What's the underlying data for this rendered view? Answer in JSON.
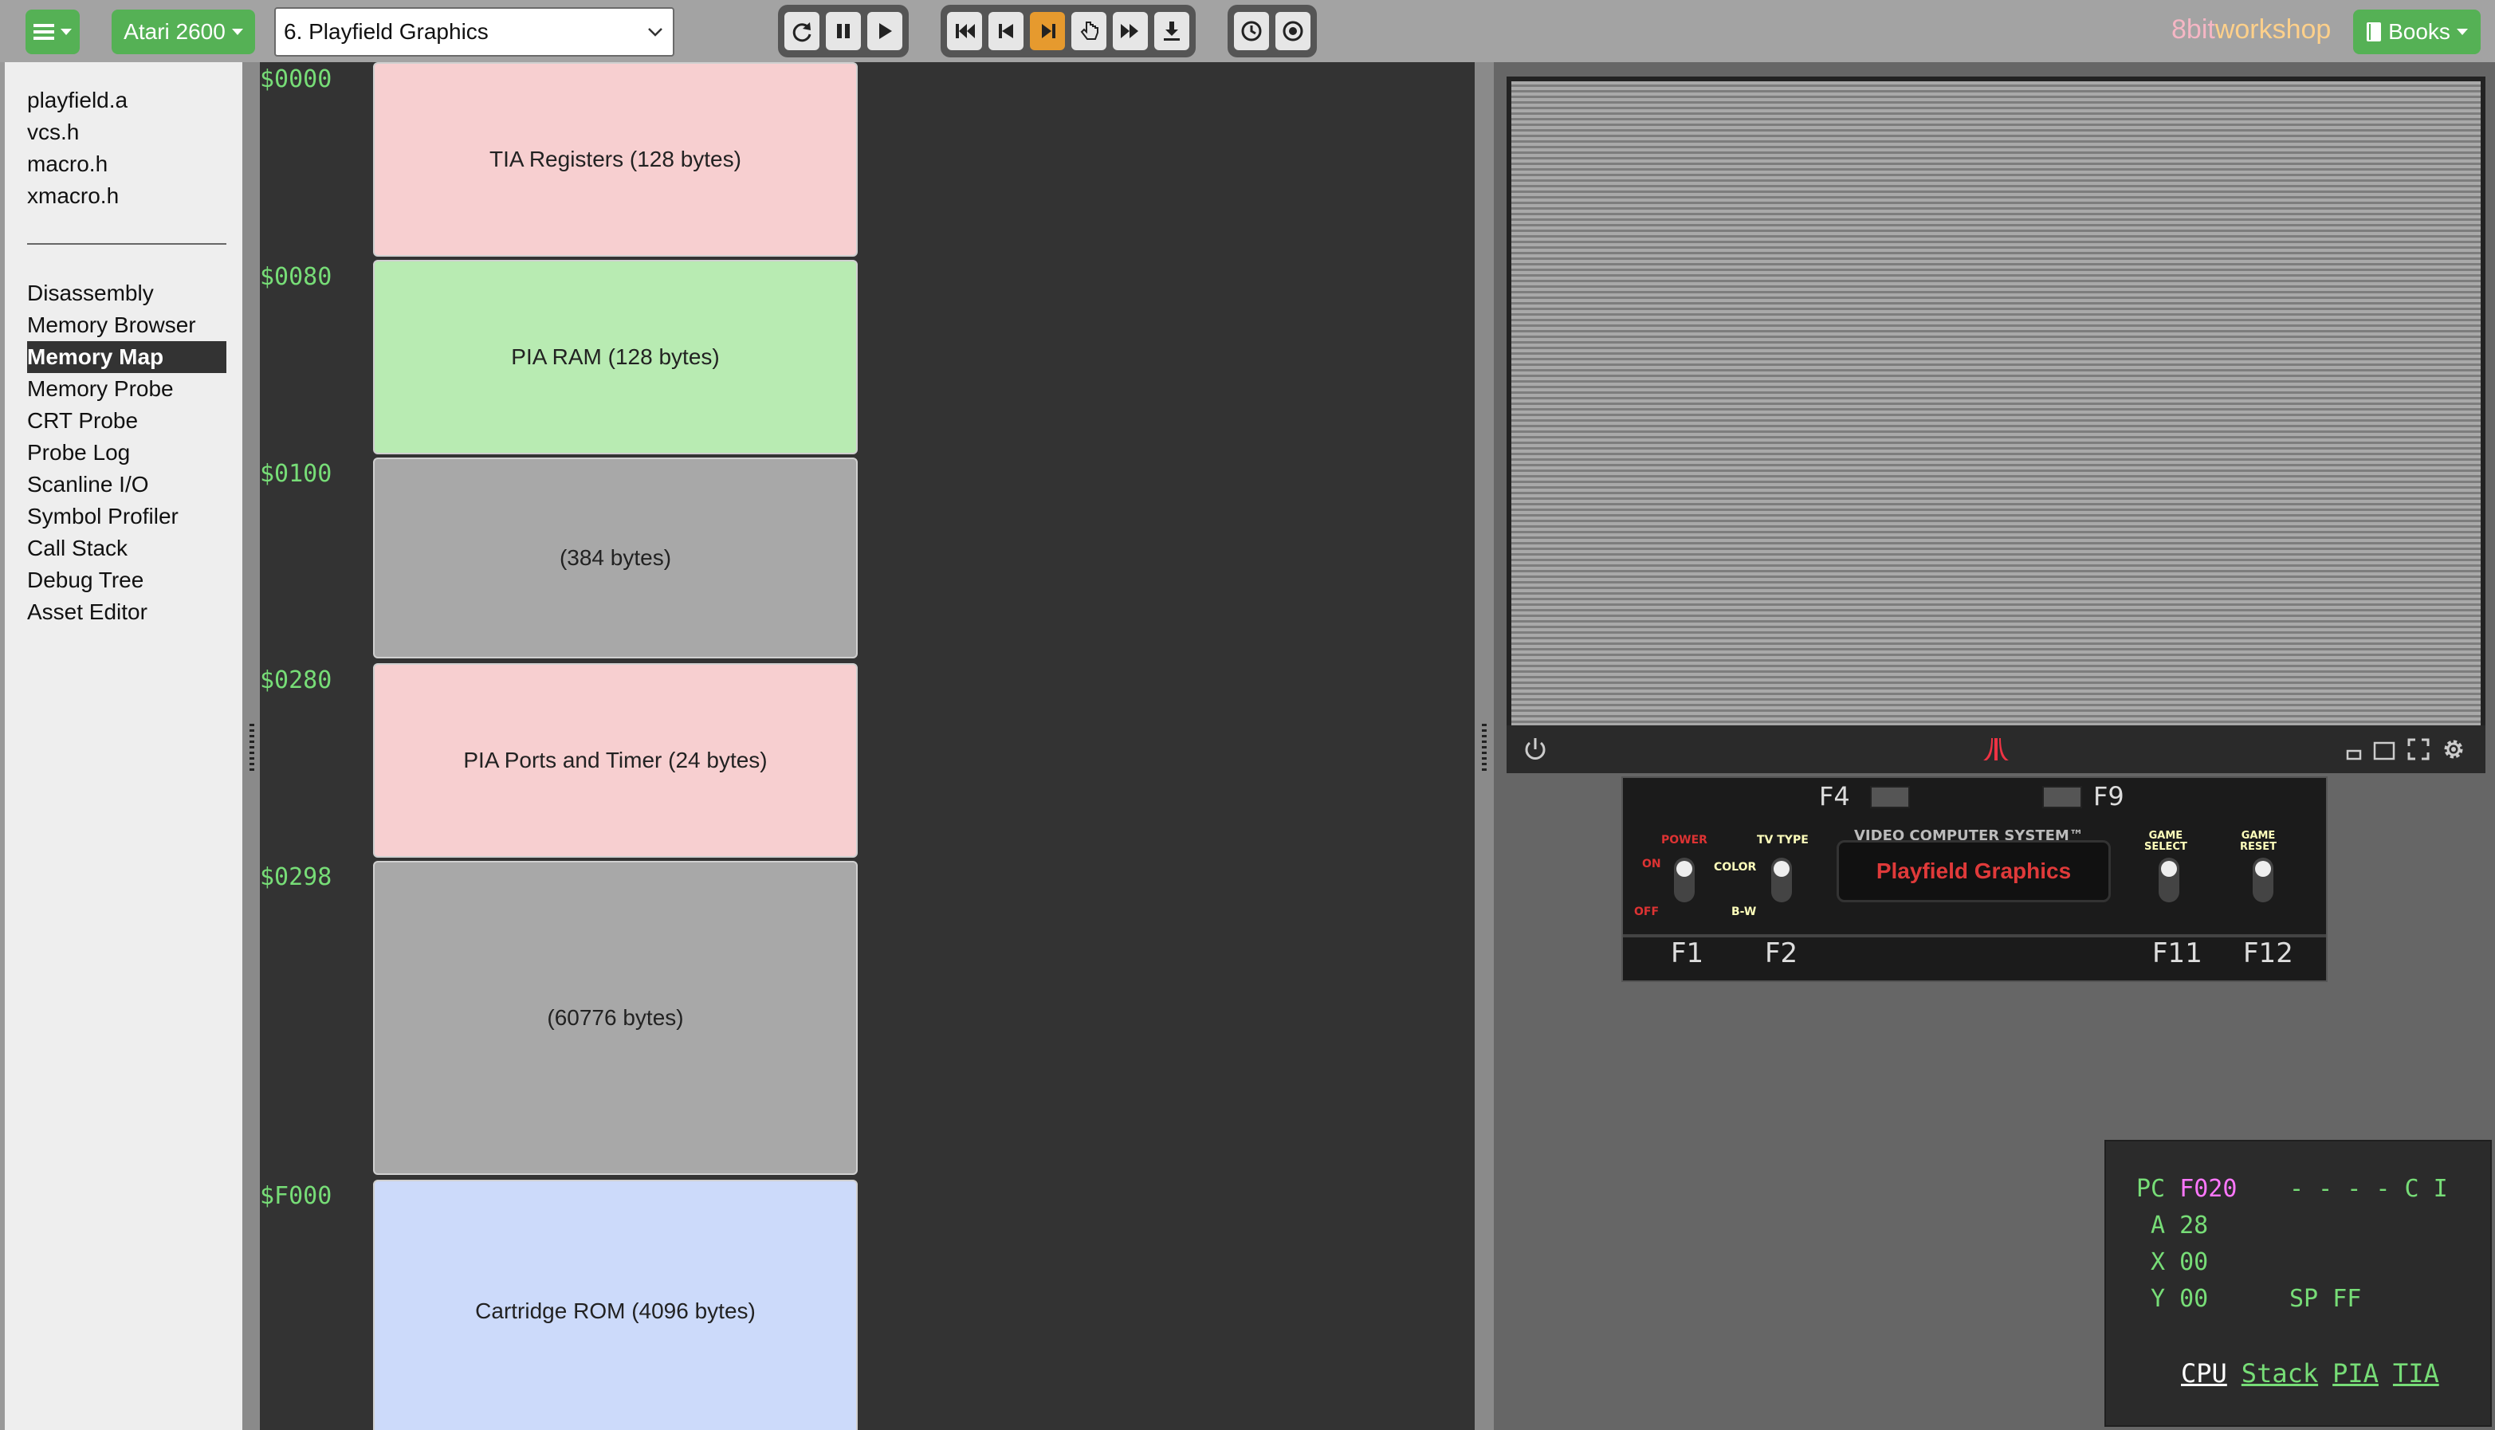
{
  "toolbar": {
    "menu_icon": "hamburger-icon",
    "platform": "Atari 2600",
    "preset": "6. Playfield Graphics",
    "brand_8bit": "8bit",
    "brand_workshop": "workshop",
    "books_label": "Books"
  },
  "sidebar": {
    "files": [
      "playfield.a",
      "vcs.h",
      "macro.h",
      "xmacro.h"
    ],
    "tools": [
      "Disassembly",
      "Memory Browser",
      "Memory Map",
      "Memory Probe",
      "CRT Probe",
      "Probe Log",
      "Scanline I/O",
      "Symbol Profiler",
      "Call Stack",
      "Debug Tree",
      "Asset Editor"
    ],
    "active_tool": "Memory Map"
  },
  "memory_map": {
    "regions": [
      {
        "addr": "$0000",
        "label": "TIA Registers (128 bytes)",
        "color": "#f7cfd0"
      },
      {
        "addr": "$0080",
        "label": "PIA RAM (128 bytes)",
        "color": "#b8ebb2"
      },
      {
        "addr": "$0100",
        "label": "(384 bytes)",
        "color": "#a8a8a8"
      },
      {
        "addr": "$0280",
        "label": "PIA Ports and Timer (24 bytes)",
        "color": "#f7cfd0"
      },
      {
        "addr": "$0298",
        "label": "(60776 bytes)",
        "color": "#a8a8a8"
      },
      {
        "addr": "$F000",
        "label": "Cartridge ROM (4096 bytes)",
        "color": "#ccdafa"
      }
    ]
  },
  "console": {
    "f4": "F4",
    "f9": "F9",
    "power": "POWER",
    "on": "ON",
    "off": "OFF",
    "tv_type": "TV TYPE",
    "color": "COLOR",
    "bw": "B-W",
    "game_select": "GAME\nSELECT",
    "game_reset": "GAME\nRESET",
    "system_name": "VIDEO COMPUTER SYSTEM™",
    "cartridge_label": "Playfield Graphics",
    "f1": "F1",
    "f2": "F2",
    "f11": "F11",
    "f12": "F12"
  },
  "cpu": {
    "pc_label": "PC",
    "pc": "F020",
    "flags": "- - - - C I",
    "a_label": "A",
    "a": "28",
    "x_label": "X",
    "x": "00",
    "y_label": "Y",
    "y": "00",
    "sp_label": "SP",
    "sp": "FF",
    "tabs": [
      "CPU",
      "Stack",
      "PIA",
      "TIA"
    ],
    "active_tab": "CPU"
  }
}
